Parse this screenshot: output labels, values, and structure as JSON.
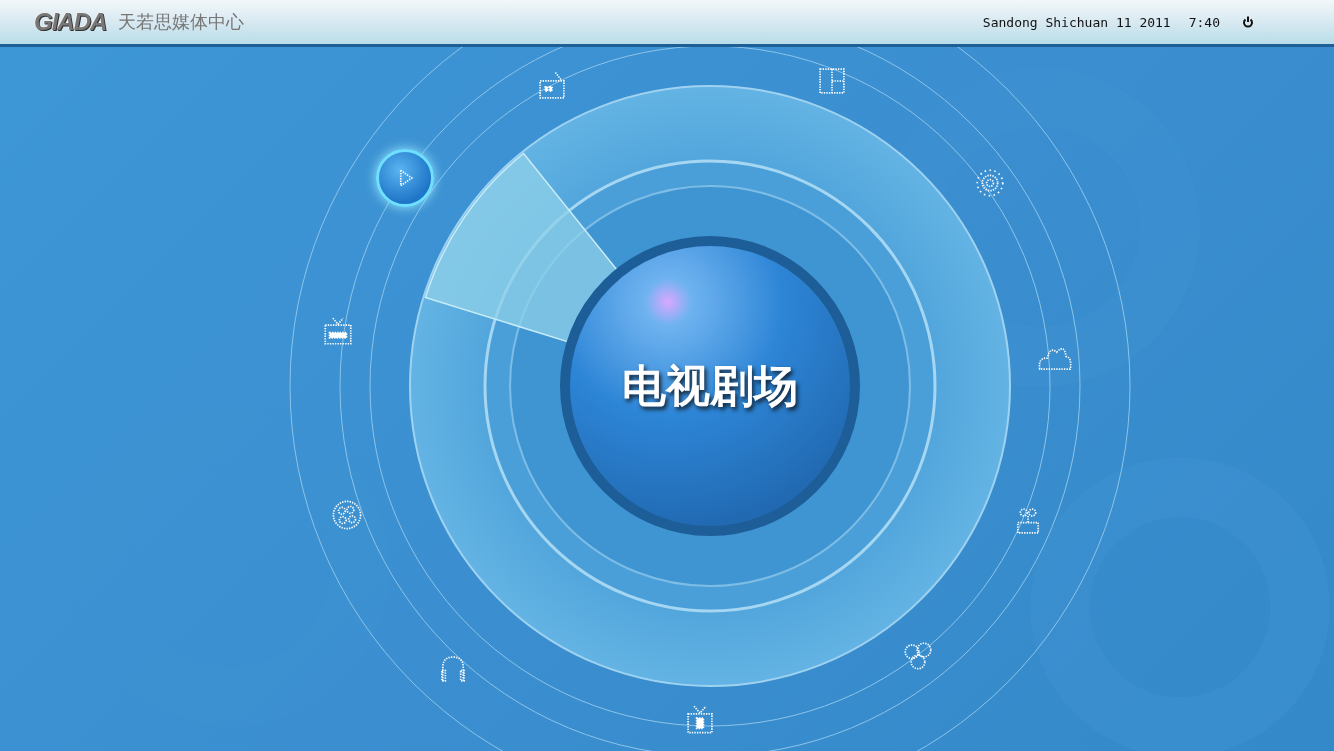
{
  "header": {
    "logo": "GIADA",
    "title": "天若思媒体中心",
    "location_date": "Sandong Shichuan 11 2011",
    "time": "7:40"
  },
  "dial": {
    "label": "电视剧场"
  },
  "menu_items": [
    {
      "kind": "radio",
      "selected": false
    },
    {
      "kind": "window",
      "selected": false
    },
    {
      "kind": "play",
      "selected": true
    },
    {
      "kind": "sparkle",
      "selected": false
    },
    {
      "kind": "tv-keyboard",
      "selected": false
    },
    {
      "kind": "cloud",
      "selected": false
    },
    {
      "kind": "reel",
      "selected": false
    },
    {
      "kind": "network",
      "selected": false
    },
    {
      "kind": "headphones",
      "selected": false
    },
    {
      "kind": "circles",
      "selected": false
    },
    {
      "kind": "tv",
      "selected": false
    }
  ]
}
